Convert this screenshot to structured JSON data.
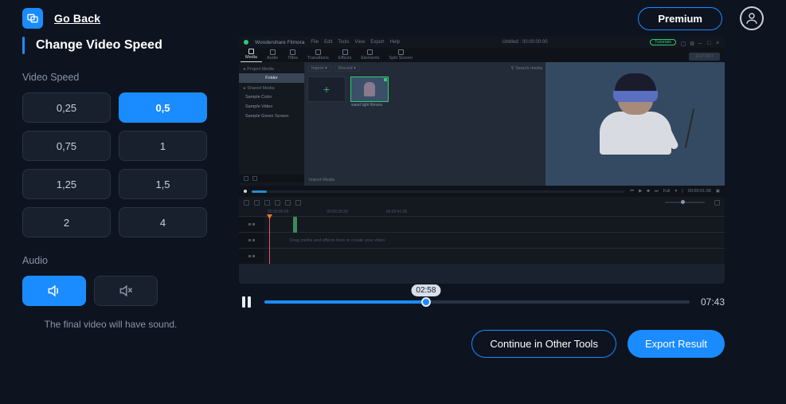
{
  "header": {
    "back_label": "Go Back",
    "premium_label": "Premium"
  },
  "panel": {
    "title": "Change Video Speed",
    "speed_section_label": "Video Speed",
    "speeds": [
      "0,25",
      "0,5",
      "0,75",
      "1",
      "1,25",
      "1,5",
      "2",
      "4"
    ],
    "selected_speed_index": 1,
    "audio_section_label": "Audio",
    "audio_on_selected": true,
    "hint": "The final video will have sound."
  },
  "preview": {
    "brand": "Wondershare Filmora",
    "menu": [
      "File",
      "Edit",
      "Tools",
      "View",
      "Export",
      "Help"
    ],
    "project_label": "Untitled : 00:00:00:00",
    "tutorials_label": "Tutorials",
    "tabs": [
      "Media",
      "Audio",
      "Titles",
      "Transitions",
      "Effects",
      "Elements",
      "Split Screen"
    ],
    "active_tab_index": 0,
    "export_label": "EXPORT",
    "sidebar_head": "Project Media",
    "sidebar": [
      "Folder",
      "Shared Media",
      "Sample Color",
      "Sample Video",
      "Sample Green Screen"
    ],
    "sidebar_selected_index": 0,
    "media_top_import": "Import",
    "media_top_record": "Record",
    "media_top_search": "Search media",
    "clip_label": "wand light filmora",
    "import_label": "Import Media",
    "transport_full": "Full",
    "transport_time": "00:00:01:08",
    "ruler": [
      "00:00:00:00",
      "",
      "00:00:20:20",
      "",
      "00:00:41:00"
    ],
    "timeline_hint": "Drag media and effects here to create your video."
  },
  "player": {
    "tooltip_time": "02:58",
    "duration": "07:43"
  },
  "footer": {
    "continue_label": "Continue in Other Tools",
    "export_label": "Export Result"
  }
}
